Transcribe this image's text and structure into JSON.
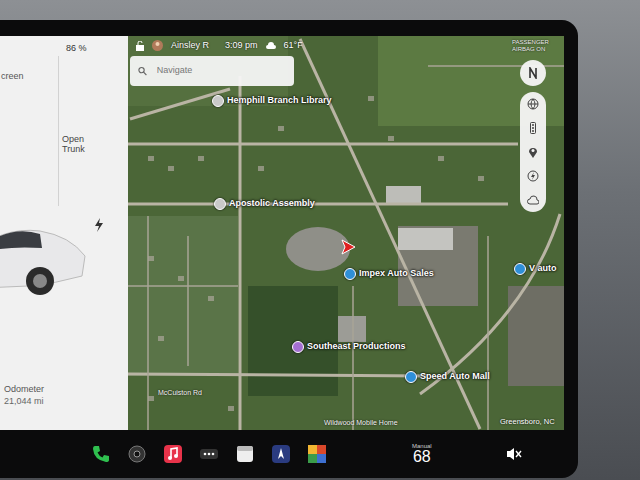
{
  "left_panel": {
    "title": "creen",
    "battery": "86 %",
    "trunk": "Open Trunk",
    "odometer_label": "Odometer",
    "odometer": "21,044 mi"
  },
  "status_bar": {
    "user": "Ainsley R",
    "time": "3:09 pm",
    "temperature": "61°F",
    "airbag": "PASSENGER AIRBAG ON"
  },
  "search": {
    "placeholder": "Navigate"
  },
  "map": {
    "places": [
      {
        "name": "Hemphill Branch Library",
        "color": "#c9c9c9"
      },
      {
        "name": "Apostolic Assembly",
        "color": "#c9c9c9"
      },
      {
        "name": "Impex Auto Sales",
        "color": "#2f8fd8"
      },
      {
        "name": "V auto",
        "color": "#2f8fd8"
      },
      {
        "name": "Southeast Productions",
        "color": "#a46fd1"
      },
      {
        "name": "Speed Auto Mall",
        "color": "#2f8fd8"
      }
    ],
    "roads": [
      "McCuiston Rd"
    ],
    "cut_label": "Wildwood Mobile Home",
    "region": "Greensboro, NC"
  },
  "dock": {
    "climate_mode": "Manual",
    "cabin_temperature": "68"
  }
}
